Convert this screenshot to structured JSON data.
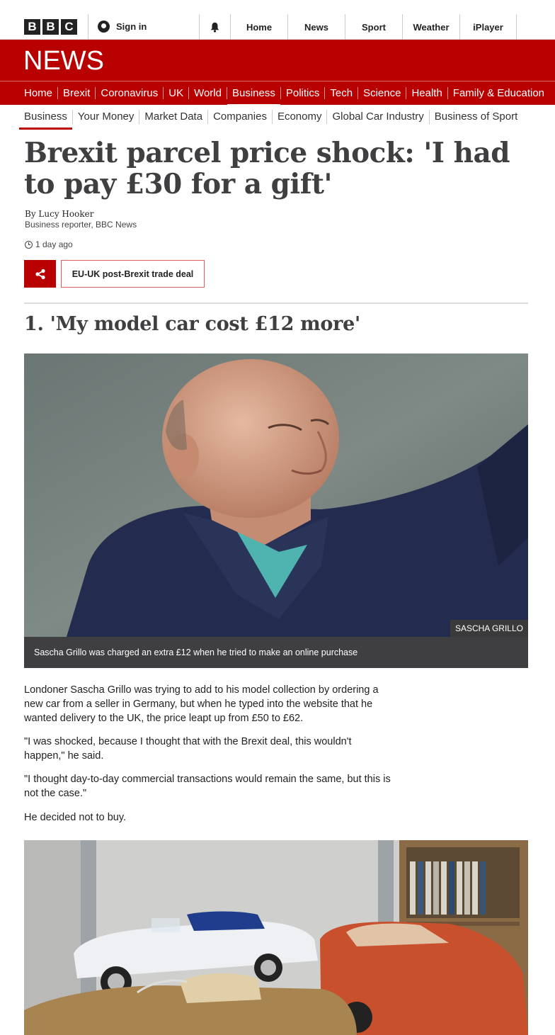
{
  "header": {
    "logo_letters": [
      "B",
      "B",
      "C"
    ],
    "signin_label": "Sign in",
    "nav": [
      "Home",
      "News",
      "Sport",
      "Weather",
      "iPlayer"
    ]
  },
  "banner": {
    "title": "NEWS"
  },
  "main_nav": [
    "Home",
    "Brexit",
    "Coronavirus",
    "UK",
    "World",
    "Business",
    "Politics",
    "Tech",
    "Science",
    "Health",
    "Family & Education"
  ],
  "main_nav_active": "Business",
  "sub_nav": [
    "Business",
    "Your Money",
    "Market Data",
    "Companies",
    "Economy",
    "Global Car Industry",
    "Business of Sport"
  ],
  "sub_nav_active": "Business",
  "article": {
    "headline": "Brexit parcel price shock: 'I had to pay £30 for a gift'",
    "author": "By Lucy Hooker",
    "author_role": "Business reporter, BBC News",
    "timestamp": "1 day ago",
    "topic_tag": "EU-UK post-Brexit trade deal",
    "section_heading": "1. 'My model car cost £12 more'",
    "image1_credit": "SASCHA GRILLO",
    "image1_caption": "Sascha Grillo was charged an extra £12 when he tried to make an online purchase",
    "paragraphs": [
      "Londoner Sascha Grillo was trying to add to his model collection by ordering a new car from a seller in Germany, but when he typed into the website that he wanted delivery to the UK, the price leapt up from £50 to £62.",
      "\"I was shocked, because I thought that with the Brexit deal, this wouldn't happen,\" he said.",
      "\"I thought day-to-day commercial transactions would remain the same, but this is not the case.\"",
      "He decided not to buy."
    ]
  },
  "colors": {
    "brand_red": "#b80000",
    "caption_bg": "#3f3f42",
    "headline": "#3f3f42"
  },
  "icons": {
    "bell": "bell-icon",
    "share": "share-icon",
    "clock": "clock-icon",
    "user": "user-icon"
  }
}
